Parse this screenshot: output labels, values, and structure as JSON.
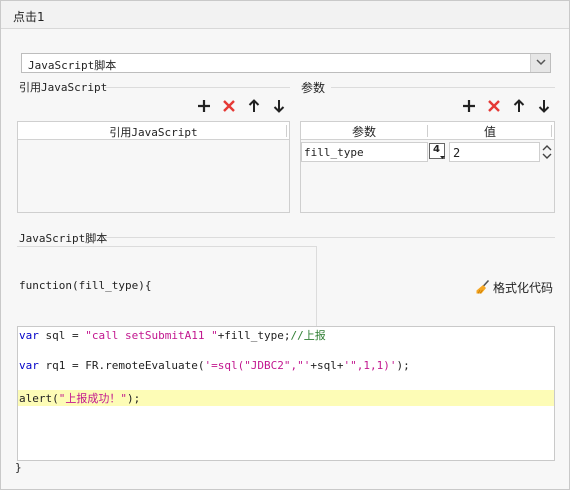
{
  "window": {
    "title": "点击1"
  },
  "script_type": {
    "selected": "JavaScript脚本"
  },
  "ref_js": {
    "section_label": "引用JavaScript",
    "column_header": "引用JavaScript",
    "toolbar": [
      "add",
      "delete",
      "move-up",
      "move-down"
    ]
  },
  "params": {
    "section_label": "参数",
    "columns": [
      "参数",
      "值"
    ],
    "rows": [
      {
        "name": "fill_type",
        "type_badge": "4",
        "value": "2"
      }
    ]
  },
  "script": {
    "section_label": "JavaScript脚本",
    "signature": "function(fill_type){",
    "format_label": "格式化代码",
    "closing": "}",
    "lines": [
      {
        "kw": "var",
        "rest": " sql = ",
        "str": "\"call setSubmitA11 \"",
        "tail": "+fill_type;",
        "cm": "//上报"
      },
      {
        "kw": "var",
        "rest": " rq1 = FR.remoteEvaluate(",
        "str": "'=sql(\"JDBC2\",\"'",
        "tail": "+sql+",
        "str2": "'\",1,1)'",
        "tail2": ");"
      },
      {
        "pre": "alert(",
        "str": "\"上报成功！\"",
        "tail": ");"
      }
    ]
  },
  "colors": {
    "keyword": "#0000c8",
    "string": "#c2178f",
    "comment": "#2e7d32",
    "delete_icon": "#e53935",
    "current_line": "#fdfcb6"
  }
}
